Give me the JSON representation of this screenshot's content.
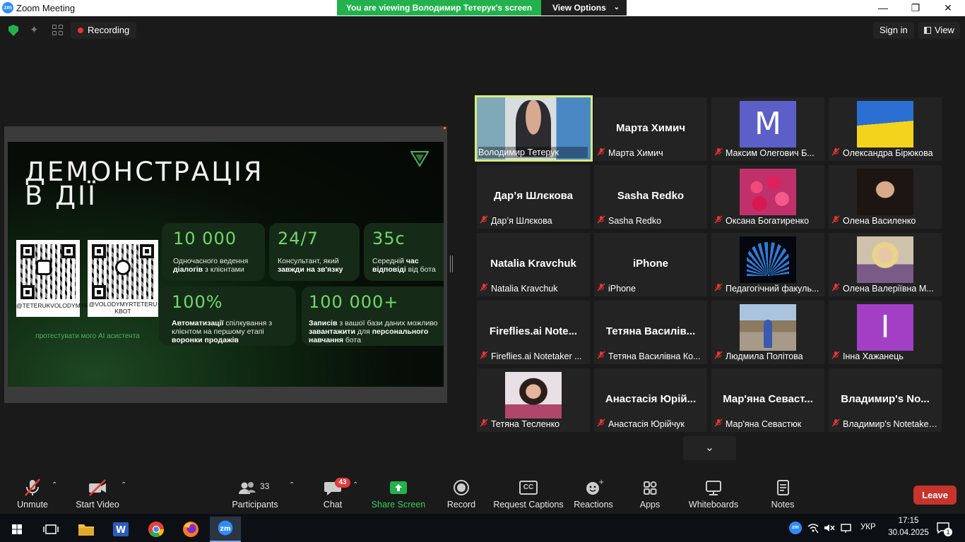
{
  "window": {
    "title": "Zoom Meeting",
    "logo_text": "zm",
    "banner_text": "You are viewing Володимир Тетерук's screen",
    "view_options_label": "View Options"
  },
  "topbar": {
    "recording_label": "Recording",
    "signin_label": "Sign in",
    "view_label": "View"
  },
  "slide": {
    "title": "ДЕМОНСТРАЦІЯ\nВ ДІЇ",
    "qr": [
      {
        "label": "@TETERUKVOLODYMYR",
        "icon": "instagram-icon"
      },
      {
        "label": "@VOLODYMYRTETERU\nKBOT",
        "icon": "telegram-icon"
      }
    ],
    "qr_caption": "протестувати мого AI асистента",
    "cards": [
      {
        "big": "10 000",
        "pre": "Одночасного ведення ",
        "bold": "діалогів",
        "post": " з клієнтами"
      },
      {
        "big": "24/7",
        "pre": "Консультант, який ",
        "bold": "завжди на зв'язку",
        "post": ""
      },
      {
        "big": "35с",
        "pre": "Середній ",
        "bold": "час відповіді",
        "post": " від бота"
      },
      {
        "big": "100%",
        "pre": "",
        "bold": "Автоматизації",
        "post": " спілкування з клієнтом на першому етапі ",
        "bold2": "воронки продажів"
      },
      {
        "big": "100 000+",
        "pre": "",
        "bold": "Записів",
        "post": " з вашої бази даних можливо ",
        "bold2": "завантажити",
        "post2": " для ",
        "bold3": "персонального навчання",
        "post3": " бота"
      }
    ]
  },
  "participants_tiles": [
    {
      "name": "Володимир Тетерук",
      "big": "",
      "kind": "video",
      "active": true
    },
    {
      "name": "Марта Химич",
      "big": "Марта Химич",
      "kind": "name"
    },
    {
      "name": "Максим Олегович Б...",
      "big": "",
      "kind": "letter",
      "letter": "M",
      "color": "#5b5fc7"
    },
    {
      "name": "Олександра Бірюкова",
      "big": "",
      "kind": "flag"
    },
    {
      "name": "Дар’я Шлєкова",
      "big": "Дар’я Шлєкова",
      "kind": "name"
    },
    {
      "name": "Sasha Redko",
      "big": "Sasha Redko",
      "kind": "name"
    },
    {
      "name": "Оксана Богатиренко",
      "big": "",
      "kind": "roses"
    },
    {
      "name": "Олена  Василенко",
      "big": "",
      "kind": "portrait-dark"
    },
    {
      "name": "Natalia Kravchuk",
      "big": "Natalia Kravchuk",
      "kind": "name"
    },
    {
      "name": "iPhone",
      "big": "iPhone",
      "kind": "name"
    },
    {
      "name": "Педагогічний факуль...",
      "big": "",
      "kind": "book-logo"
    },
    {
      "name": "Олена Валеріївна М...",
      "big": "",
      "kind": "portrait-light"
    },
    {
      "name": "Fireflies.ai Notetaker ...",
      "big": "Fireflies.ai  Note...",
      "kind": "name"
    },
    {
      "name": "Тетяна Василівна Ко...",
      "big": "Тетяна  Василів...",
      "kind": "name"
    },
    {
      "name": "Людмила Політова",
      "big": "",
      "kind": "street"
    },
    {
      "name": "Інна Хажанець",
      "big": "",
      "kind": "letter",
      "letter": "I",
      "color": "#a23fc4"
    },
    {
      "name": "Тетяна Тесленко",
      "big": "",
      "kind": "portrait-woman"
    },
    {
      "name": "Анастасія Юрійчук",
      "big": "Анастасія  Юрій...",
      "kind": "name"
    },
    {
      "name": "Мар'яна Севастюк",
      "big": "Мар'яна  Севаст...",
      "kind": "name"
    },
    {
      "name": "Владимир's Notetaker (...",
      "big": "Владимир's  No...",
      "kind": "name"
    }
  ],
  "toolbar": {
    "unmute": "Unmute",
    "start_video": "Start Video",
    "participants": "Participants",
    "participants_count": "33",
    "chat": "Chat",
    "chat_badge": "43",
    "share_screen": "Share Screen",
    "record": "Record",
    "captions": "Request Captions",
    "reactions": "Reactions",
    "apps": "Apps",
    "whiteboards": "Whiteboards",
    "notes": "Notes",
    "leave": "Leave",
    "captions_glyph": "CC"
  },
  "taskbar": {
    "lang": "УКР",
    "time": "17:15",
    "date": "30.04.2025",
    "notif_count": "1"
  },
  "colors": {
    "share_green": "#23b14d",
    "leave_red": "#c7342c",
    "active_border": "#d4ee7a",
    "muted_red": "#e33333"
  }
}
